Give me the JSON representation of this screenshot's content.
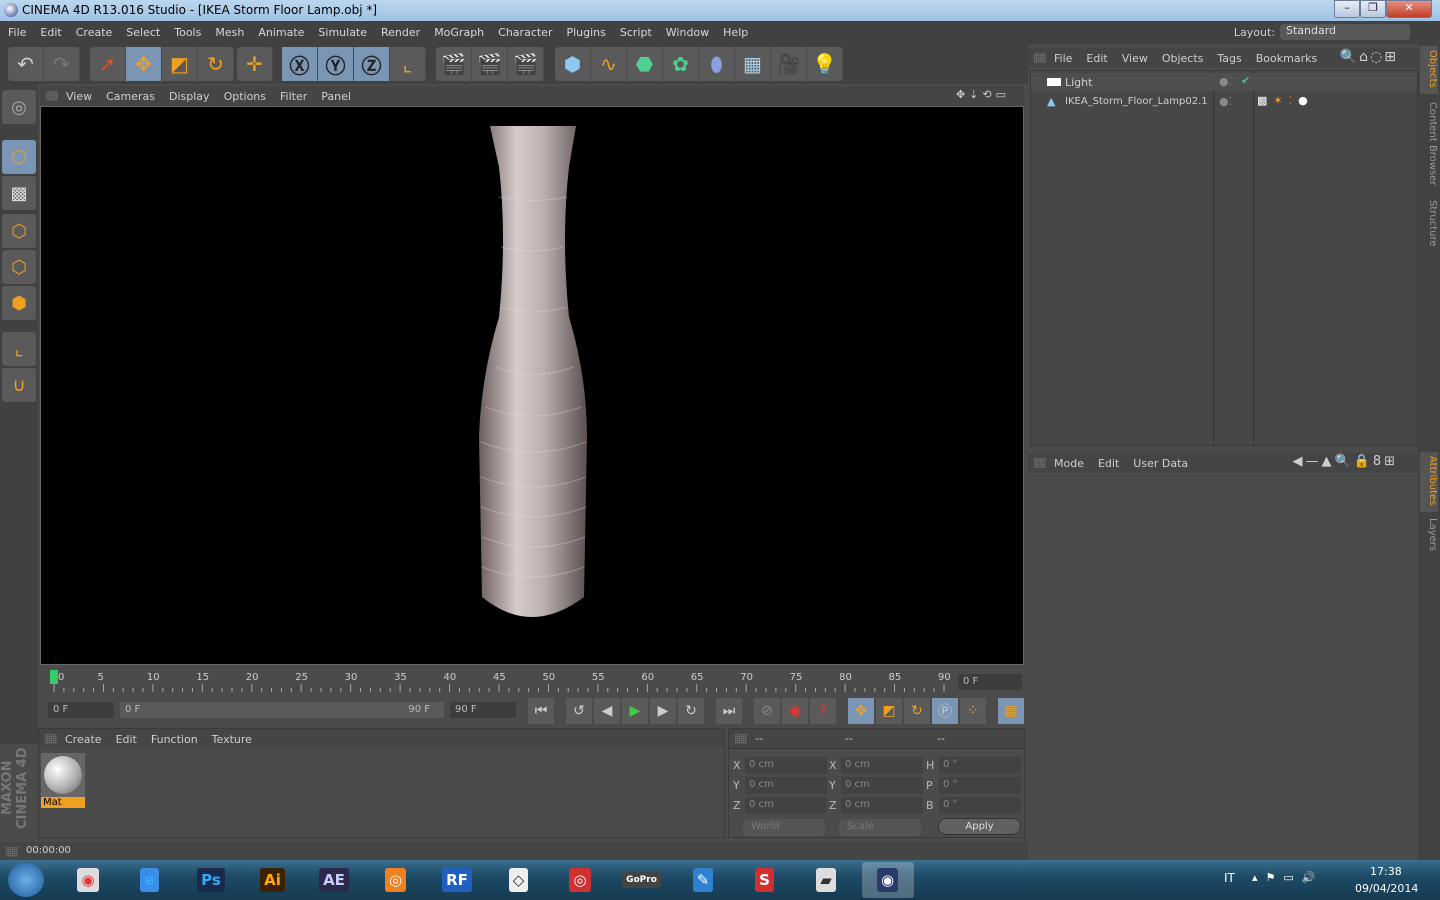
{
  "window": {
    "title": "CINEMA 4D R13.016 Studio - [IKEA Storm Floor Lamp.obj *]"
  },
  "menu": [
    "File",
    "Edit",
    "Create",
    "Select",
    "Tools",
    "Mesh",
    "Animate",
    "Simulate",
    "Render",
    "MoGraph",
    "Character",
    "Plugins",
    "Script",
    "Window",
    "Help"
  ],
  "layout": {
    "label": "Layout:",
    "value": "Standard"
  },
  "viewport": {
    "menu": [
      "View",
      "Cameras",
      "Display",
      "Options",
      "Filter",
      "Panel"
    ]
  },
  "objects": {
    "menu": [
      "File",
      "Edit",
      "View",
      "Objects",
      "Tags",
      "Bookmarks"
    ],
    "items": [
      {
        "name": "Light"
      },
      {
        "name": "IKEA_Storm_Floor_Lamp02.1"
      }
    ]
  },
  "attributes": {
    "menu": [
      "Mode",
      "Edit",
      "User Data"
    ]
  },
  "side_tabs": [
    "Objects",
    "Content Browser",
    "Structure",
    "Attributes",
    "Layers"
  ],
  "timeline": {
    "min": 0,
    "max": 90,
    "step": 5,
    "current_frame": "0 F",
    "start": "0 F",
    "range_start": "0 F",
    "range_end": "90 F",
    "end": "90 F"
  },
  "materials": {
    "menu": [
      "Create",
      "Edit",
      "Function",
      "Texture"
    ],
    "items": [
      {
        "name": "Mat"
      }
    ],
    "brand": "MAXON CINEMA 4D"
  },
  "coords": {
    "headers": [
      "--",
      "--",
      "--"
    ],
    "rows": [
      {
        "a": "X",
        "av": "0 cm",
        "b": "X",
        "bv": "0 cm",
        "c": "H",
        "cv": "0 °"
      },
      {
        "a": "Y",
        "av": "0 cm",
        "b": "Y",
        "bv": "0 cm",
        "c": "P",
        "cv": "0 °"
      },
      {
        "a": "Z",
        "av": "0 cm",
        "b": "Z",
        "bv": "0 cm",
        "c": "B",
        "cv": "0 °"
      }
    ],
    "world": "World",
    "scale": "Scale",
    "apply": "Apply"
  },
  "status": {
    "time": "00:00:00"
  },
  "taskbar": {
    "apps": [
      "Chrome",
      "Internet Explorer",
      "Ps",
      "Ai",
      "AE",
      "Blender",
      "RF",
      "Unity",
      "Picasa",
      "GoPro",
      "Sketch",
      "SketchUp",
      "Rhino",
      "Cinema 4D"
    ],
    "lang": "IT",
    "time": "17:38",
    "date": "09/04/2014"
  },
  "colors": {
    "accent": "#7b95b5",
    "orange": "#f0a020",
    "viewport_bg": "#000000"
  }
}
